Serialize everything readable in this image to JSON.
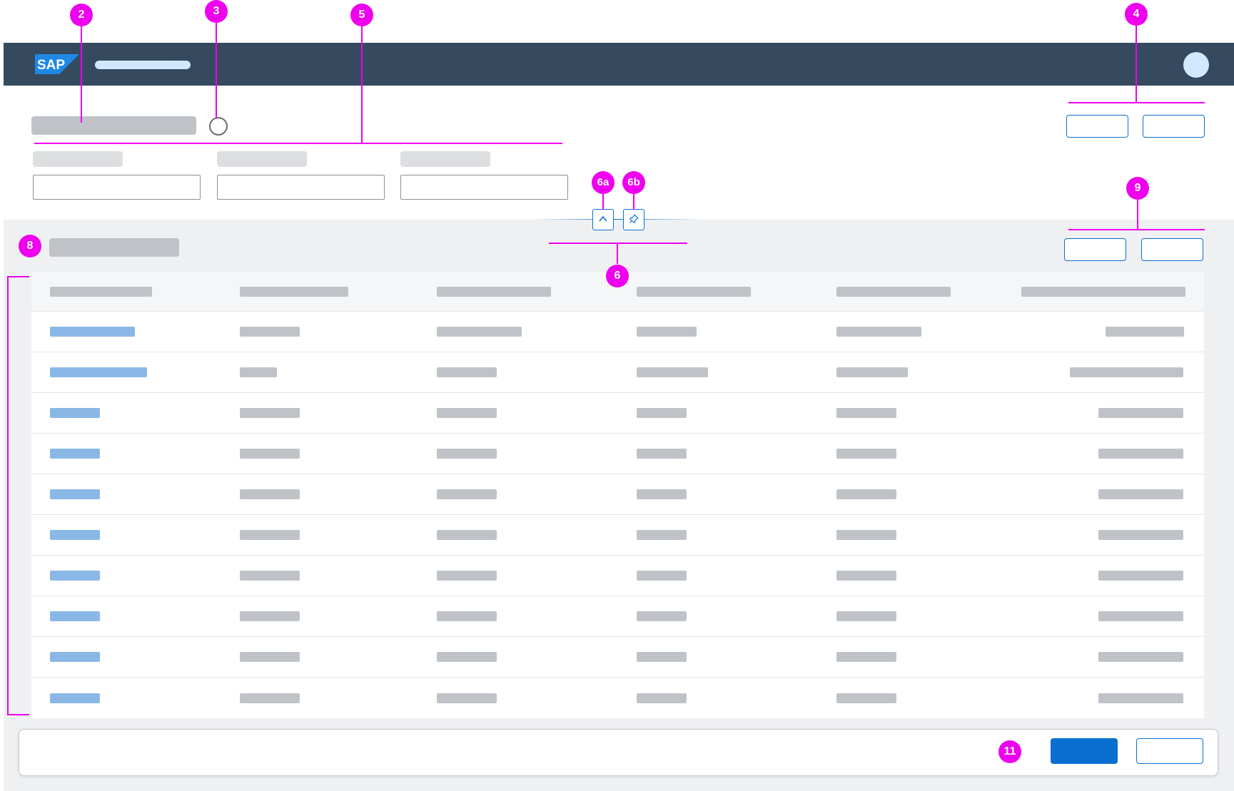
{
  "shell": {
    "logo_text": "SAP",
    "logo_icon": "sap-logo-icon",
    "avatar_icon": "avatar-icon"
  },
  "header_controls": {
    "collapse_icon": "chevron-up-icon",
    "pin_icon": "pin-icon"
  },
  "annotations": {
    "badge_2": "2",
    "badge_3": "3",
    "badge_4": "4",
    "badge_5": "5",
    "badge_6": "6",
    "badge_6a": "6a",
    "badge_6b": "6b",
    "badge_8": "8",
    "badge_9": "9",
    "badge_11": "11"
  },
  "colors": {
    "shell_bar": "#354a5f",
    "annotation": "#ee00ee",
    "emphasized_button": "#0a6ed1",
    "link_placeholder": "#8ab8e6",
    "text_placeholder": "#bfc3c7"
  }
}
